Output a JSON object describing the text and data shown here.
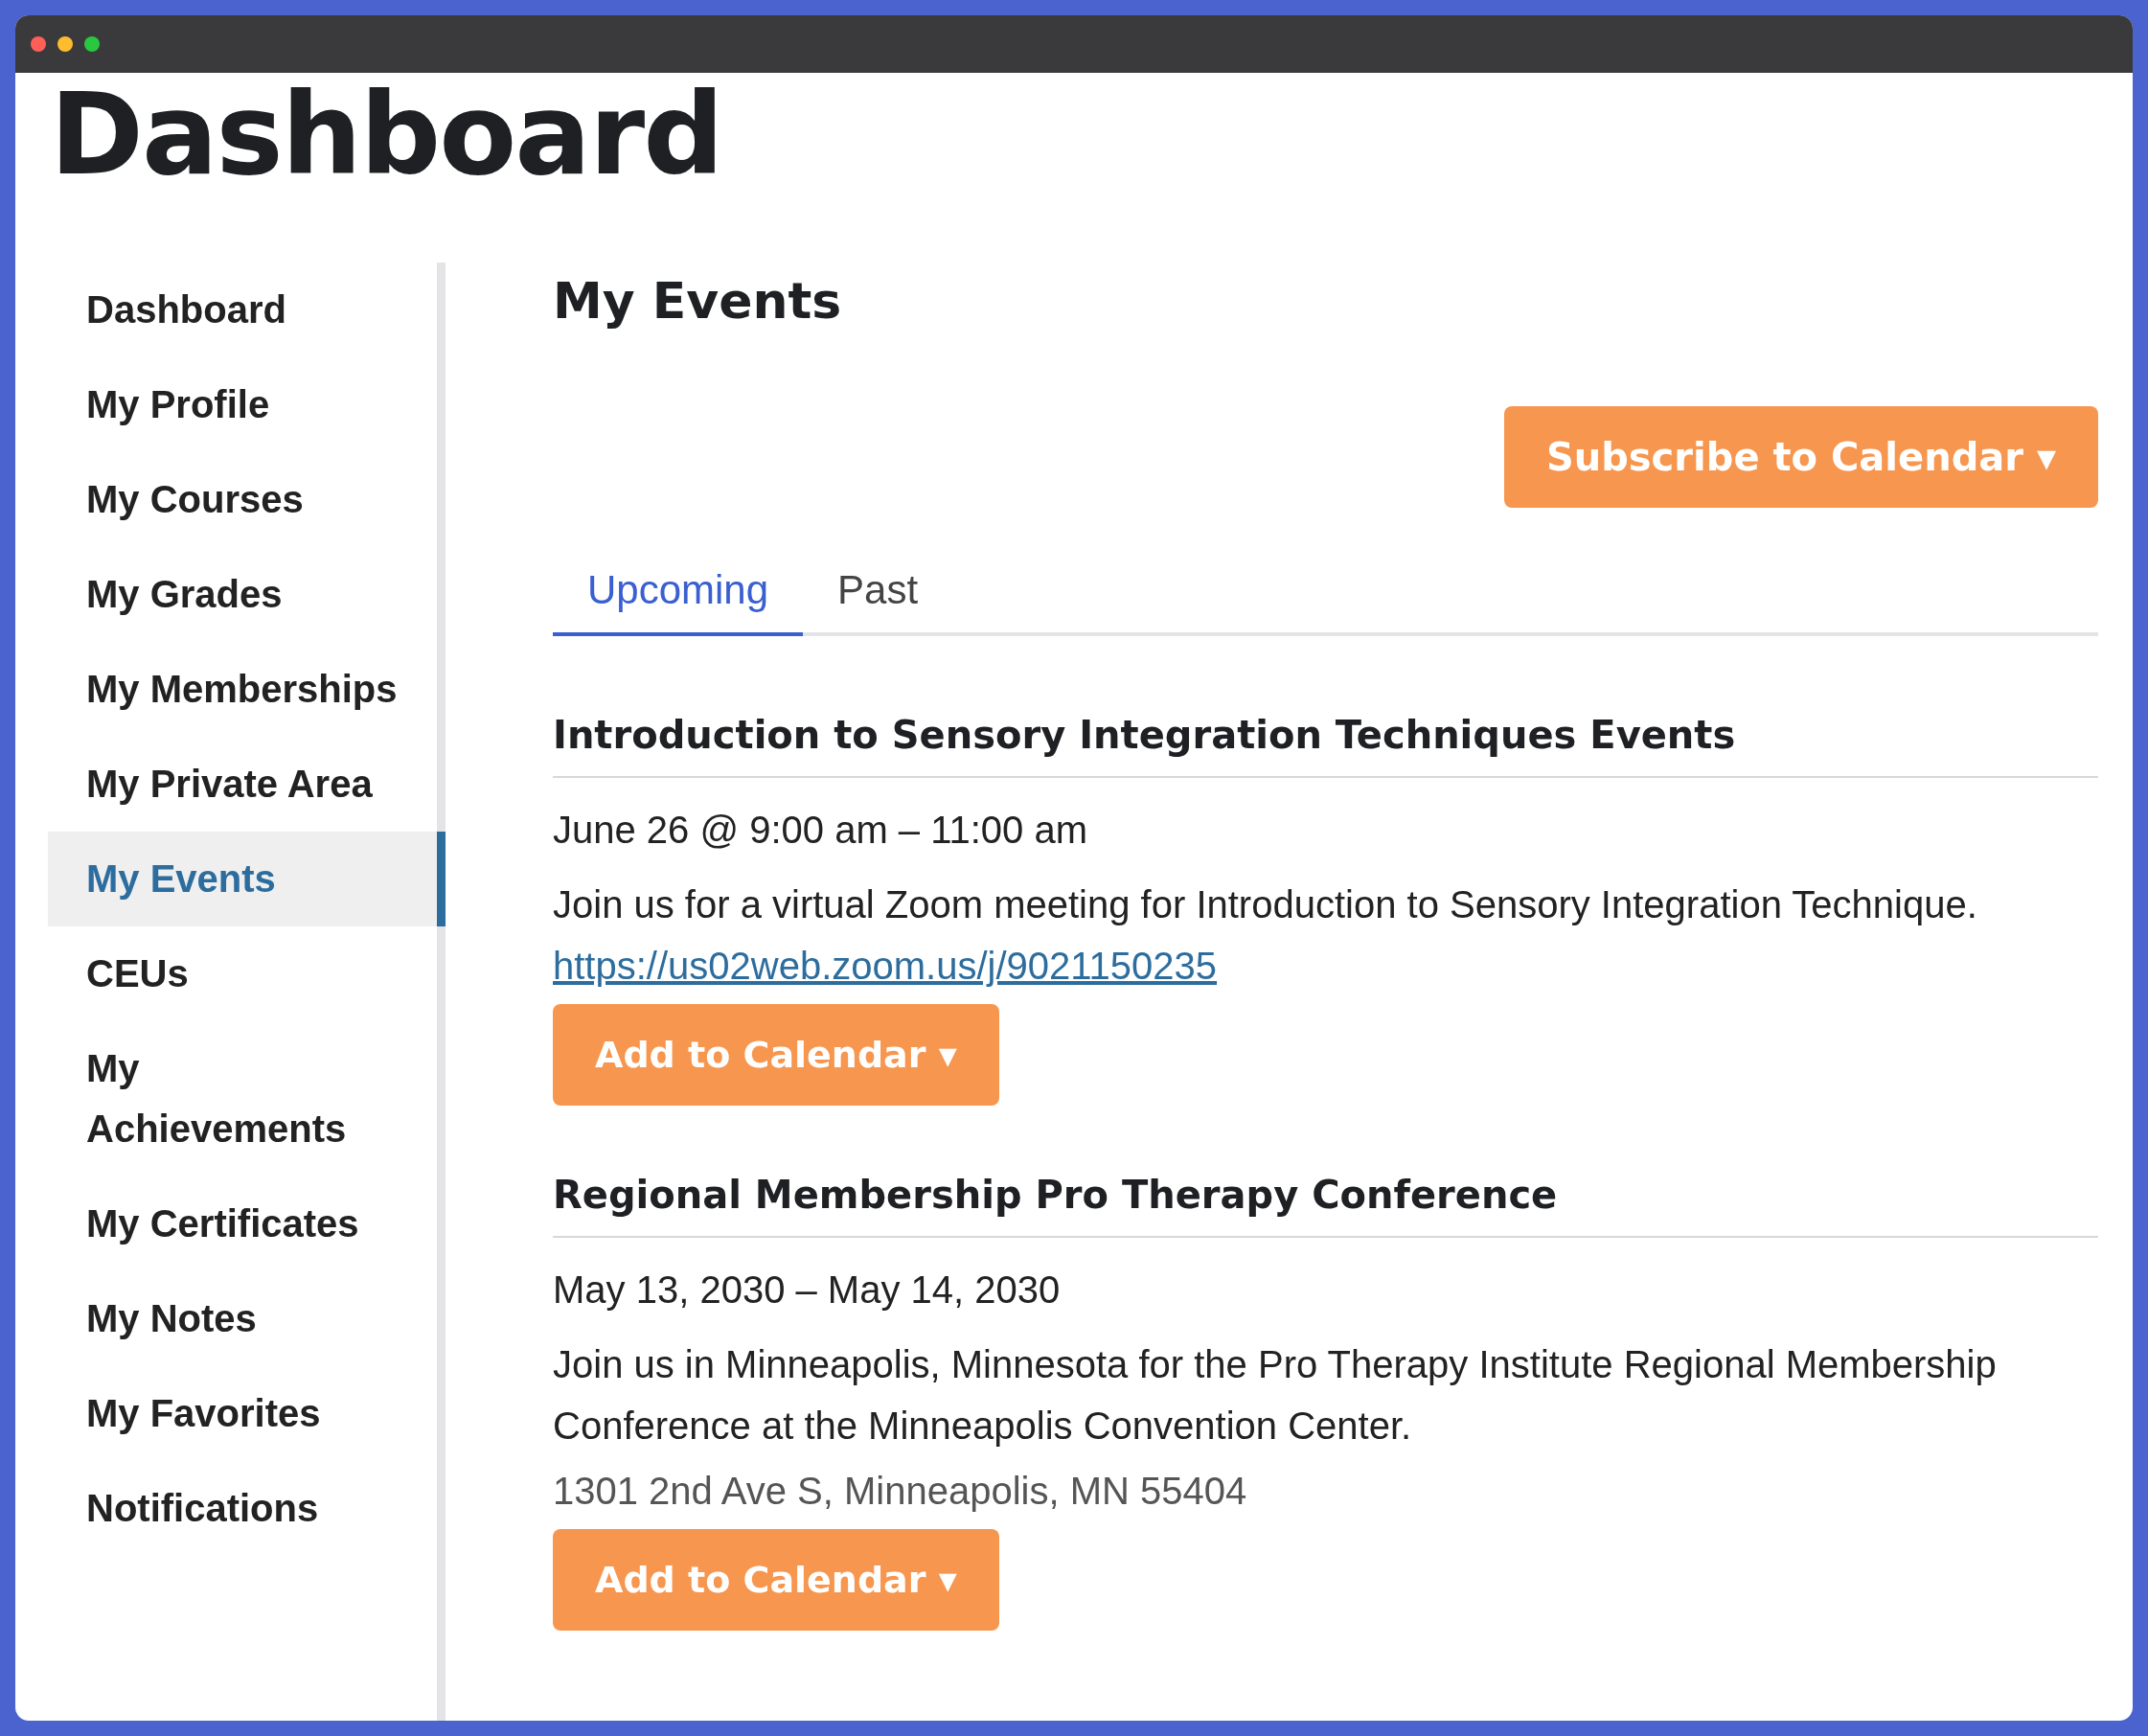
{
  "page_title": "Dashboard",
  "sidebar": {
    "items": [
      {
        "label": "Dashboard",
        "selected": false
      },
      {
        "label": "My Profile",
        "selected": false
      },
      {
        "label": "My Courses",
        "selected": false
      },
      {
        "label": "My Grades",
        "selected": false
      },
      {
        "label": "My Memberships",
        "selected": false
      },
      {
        "label": "My Private Area",
        "selected": false
      },
      {
        "label": "My Events",
        "selected": true
      },
      {
        "label": "CEUs",
        "selected": false
      },
      {
        "label": "My Achievements",
        "selected": false
      },
      {
        "label": "My Certificates",
        "selected": false
      },
      {
        "label": "My Notes",
        "selected": false
      },
      {
        "label": "My Favorites",
        "selected": false
      },
      {
        "label": "Notifications",
        "selected": false
      }
    ]
  },
  "main": {
    "heading": "My Events",
    "subscribe_button": "Subscribe to Calendar ▾",
    "tabs": [
      {
        "label": "Upcoming",
        "selected": true
      },
      {
        "label": "Past",
        "selected": false
      }
    ],
    "events": [
      {
        "title": "Introduction to Sensory Integration Techniques Events",
        "date": "June 26 @ 9:00 am – 11:00 am",
        "description": "Join us for a virtual Zoom meeting for Introduction to Sensory Integration Technique.",
        "link": "https://us02web.zoom.us/j/9021150235",
        "button": "Add to Calendar ▾"
      },
      {
        "title": "Regional Membership Pro Therapy Conference",
        "date": "May 13, 2030 – May 14, 2030",
        "description": "Join us in Minneapolis, Minnesota for the Pro Therapy Institute Regional Membership Conference at the Minneapolis Convention Center.",
        "address": "1301 2nd Ave S, Minneapolis, MN 55404",
        "button": "Add to Calendar ▾"
      }
    ]
  }
}
